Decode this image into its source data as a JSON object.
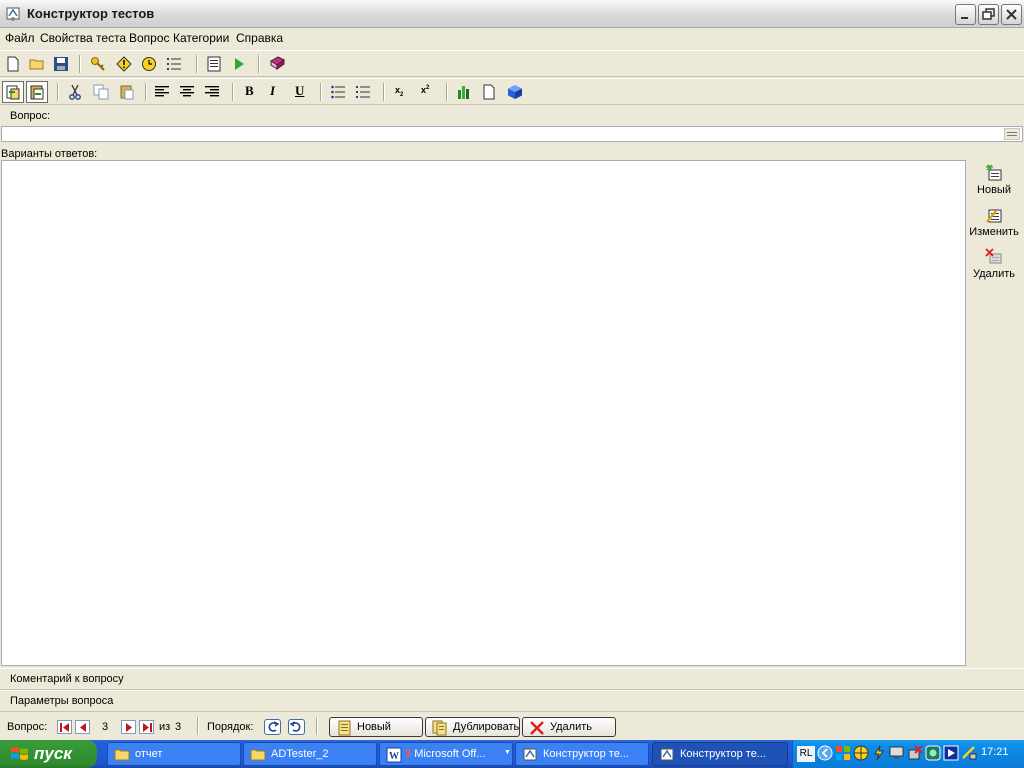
{
  "window": {
    "title": "Конструктор тестов"
  },
  "menu": [
    "Файл",
    "Свойства теста",
    "Вопрос",
    "Категории",
    "Справка"
  ],
  "toolbar1": {
    "icons": [
      "new-doc-icon",
      "open-folder-icon",
      "save-icon",
      "key-icon",
      "warning-icon",
      "clock-icon",
      "numbered-list-icon",
      "form-icon",
      "run-icon",
      "book-icon"
    ]
  },
  "toolbar2": {
    "icons": [
      "paste-special-icon",
      "paste-icon",
      "cut-icon",
      "copy-icon",
      "paste2-icon",
      "align-left-icon",
      "align-center-icon",
      "align-right-icon",
      "bold-icon",
      "italic-icon",
      "underline-icon",
      "bullet-list-icon",
      "numbered-list-icon",
      "subscript-icon",
      "superscript-icon",
      "chart-icon",
      "page-icon",
      "cube-icon"
    ],
    "bold": "B",
    "italic": "I",
    "underline": "U",
    "subscript": "x",
    "sub_mark": "2",
    "superscript": "x",
    "sup_mark": "2"
  },
  "question": {
    "label": "Вопрос:",
    "value": ""
  },
  "answers": {
    "label": "Варианты ответов:",
    "side_buttons": [
      "Новый",
      "Изменить",
      "Удалить"
    ]
  },
  "sections": [
    "Коментарий к вопросу",
    "Параметры вопроса"
  ],
  "navigation": {
    "label": "Вопрос:",
    "current": "3",
    "of_label": "из",
    "total": "3",
    "order_label": "Порядок:",
    "buttons": [
      "Новый",
      "Дублировать",
      "Удалить"
    ]
  },
  "taskbar": {
    "start": "пуск",
    "tasks": [
      {
        "label": "отчет",
        "icon": "folder-icon"
      },
      {
        "label": "ADTester_2",
        "icon": "folder-icon"
      },
      {
        "label": "Microsoft Off...",
        "count": "3",
        "icon": "word-icon"
      },
      {
        "label": "Конструктор те...",
        "icon": "app-icon"
      },
      {
        "label": "Конструктор те...",
        "icon": "app-icon",
        "active": true
      }
    ],
    "lang": "RL",
    "clock": "17:21"
  },
  "colors": {
    "taskbar": "#245edb",
    "start": "#379937",
    "accent": "#316ac5"
  }
}
